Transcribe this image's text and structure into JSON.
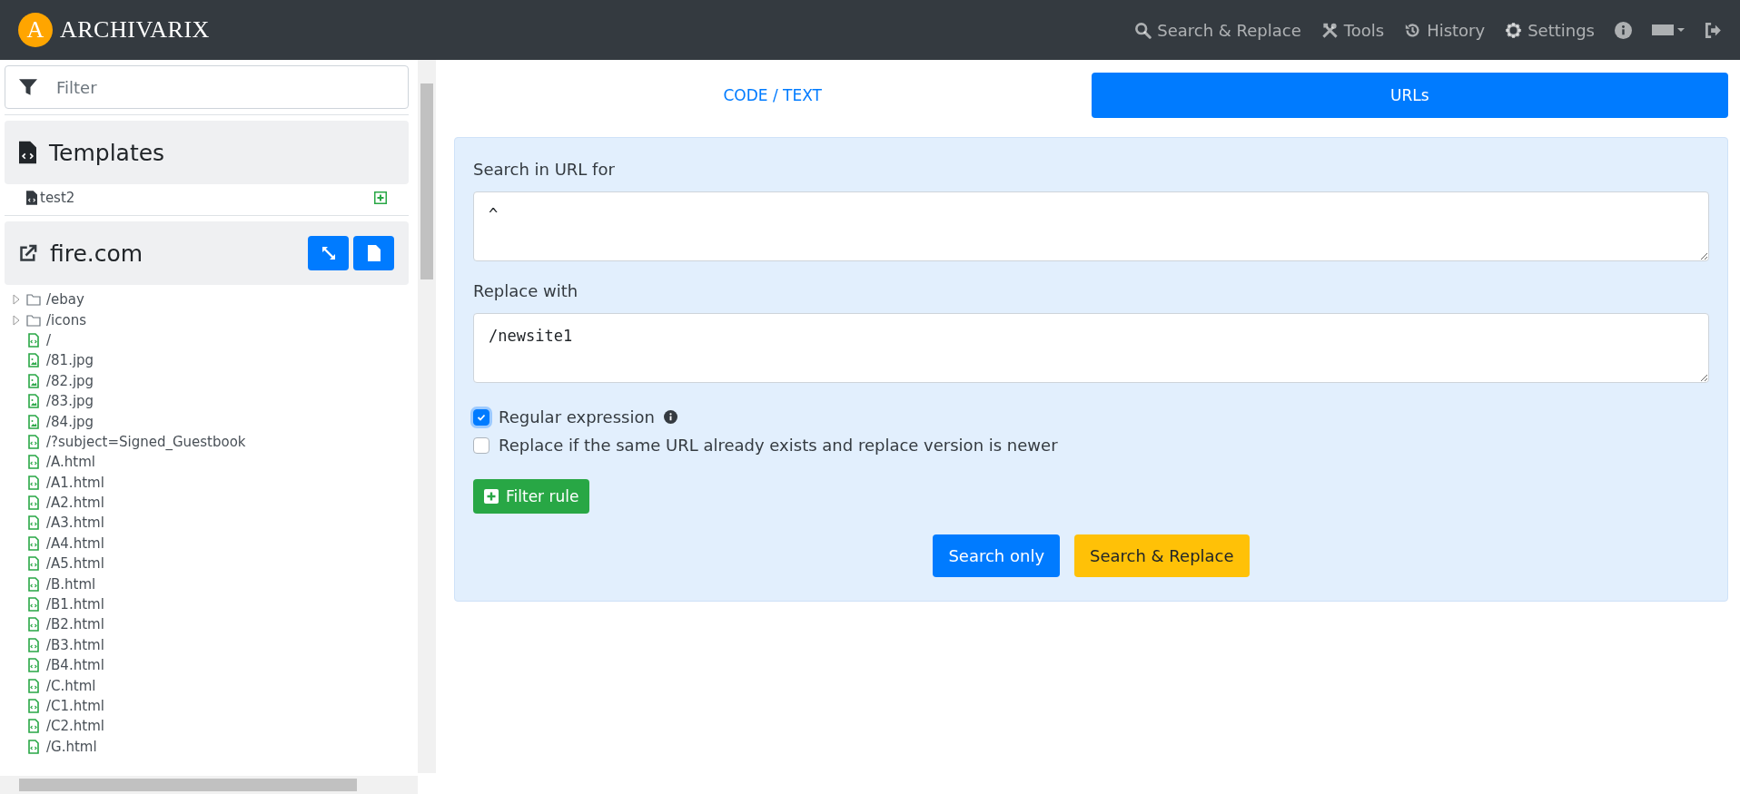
{
  "navbar": {
    "logo_letter": "A",
    "brand": "ARCHIVARIX",
    "items": [
      {
        "label": "Search & Replace"
      },
      {
        "label": "Tools"
      },
      {
        "label": "History"
      },
      {
        "label": "Settings"
      }
    ]
  },
  "sidebar": {
    "filter": {
      "placeholder": "Filter"
    },
    "templates": {
      "title": "Templates",
      "items": [
        {
          "name": "test2"
        }
      ]
    },
    "site": {
      "title": "fire.com",
      "tree": [
        {
          "kind": "folder",
          "name": "/ebay",
          "expanded": false
        },
        {
          "kind": "folder",
          "name": "/icons",
          "expanded": false
        },
        {
          "kind": "page",
          "name": "/"
        },
        {
          "kind": "image",
          "name": "/81.jpg"
        },
        {
          "kind": "image",
          "name": "/82.jpg"
        },
        {
          "kind": "image",
          "name": "/83.jpg"
        },
        {
          "kind": "image",
          "name": "/84.jpg"
        },
        {
          "kind": "page",
          "name": "/?subject=Signed_Guestbook"
        },
        {
          "kind": "page",
          "name": "/A.html"
        },
        {
          "kind": "page",
          "name": "/A1.html"
        },
        {
          "kind": "page",
          "name": "/A2.html"
        },
        {
          "kind": "page",
          "name": "/A3.html"
        },
        {
          "kind": "page",
          "name": "/A4.html"
        },
        {
          "kind": "page",
          "name": "/A5.html"
        },
        {
          "kind": "page",
          "name": "/B.html"
        },
        {
          "kind": "page",
          "name": "/B1.html"
        },
        {
          "kind": "page",
          "name": "/B2.html"
        },
        {
          "kind": "page",
          "name": "/B3.html"
        },
        {
          "kind": "page",
          "name": "/B4.html"
        },
        {
          "kind": "page",
          "name": "/C.html"
        },
        {
          "kind": "page",
          "name": "/C1.html"
        },
        {
          "kind": "page",
          "name": "/C2.html"
        },
        {
          "kind": "page",
          "name": "/G.html"
        }
      ]
    }
  },
  "tabs": [
    {
      "label": "CODE / TEXT",
      "selected": false
    },
    {
      "label": "URLs",
      "selected": true
    }
  ],
  "form": {
    "search_label": "Search in URL for",
    "search_value": "^",
    "replace_label": "Replace with",
    "replace_value": "/newsite1",
    "options": [
      {
        "label": "Regular expression",
        "checked": true,
        "info": true
      },
      {
        "label": "Replace if the same URL already exists and replace version is newer",
        "checked": false,
        "info": false
      }
    ],
    "filter_button": "Filter rule",
    "buttons": [
      {
        "label": "Search only",
        "kind": "primary"
      },
      {
        "label": "Search & Replace",
        "kind": "warning"
      }
    ]
  }
}
